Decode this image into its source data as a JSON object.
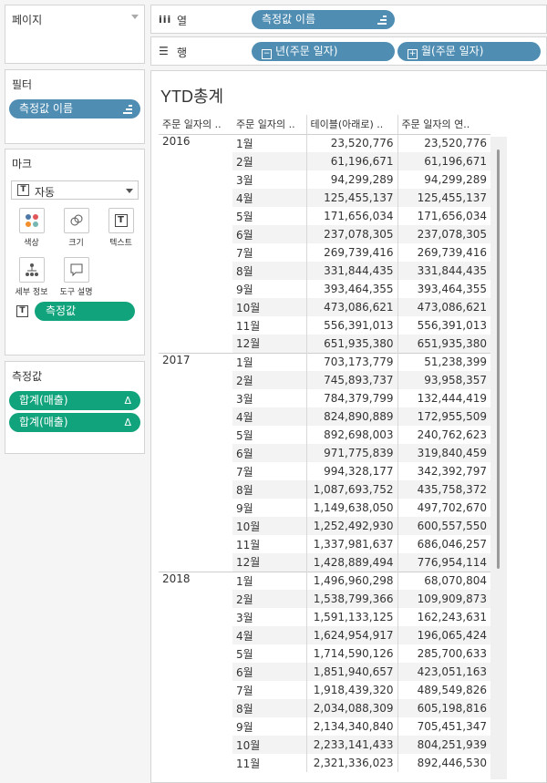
{
  "left": {
    "pages_title": "페이지",
    "filters_title": "필터",
    "filter_pill": "측정값 이름",
    "marks_title": "마크",
    "mark_type": "자동",
    "cards": [
      {
        "label": "색상",
        "icon": "color-dots-icon"
      },
      {
        "label": "크기",
        "icon": "size-circle-icon"
      },
      {
        "label": "텍스트",
        "icon": "text-box-icon"
      },
      {
        "label": "세부 정보",
        "icon": "detail-tree-icon"
      },
      {
        "label": "도구 설명",
        "icon": "tooltip-bubble-icon"
      }
    ],
    "text_pill": "측정값",
    "measures_title": "측정값",
    "measure_pills": [
      "합계(매출)",
      "합계(매출)"
    ]
  },
  "shelves": {
    "columns_label": "열",
    "columns_pill": "측정값 이름",
    "rows_label": "행",
    "rows_pills": [
      "년(주문 일자)",
      "월(주문 일자)"
    ]
  },
  "view": {
    "title": "YTD총계",
    "headers": [
      "주문 일자의 ..",
      "주문 일자의 ..",
      "테이블(아래로) ..",
      "주문 일자의 연.."
    ],
    "groups": [
      {
        "year": "2016",
        "rows": [
          [
            "1월",
            "23,520,776",
            "23,520,776"
          ],
          [
            "2월",
            "61,196,671",
            "61,196,671"
          ],
          [
            "3월",
            "94,299,289",
            "94,299,289"
          ],
          [
            "4월",
            "125,455,137",
            "125,455,137"
          ],
          [
            "5월",
            "171,656,034",
            "171,656,034"
          ],
          [
            "6월",
            "237,078,305",
            "237,078,305"
          ],
          [
            "7월",
            "269,739,416",
            "269,739,416"
          ],
          [
            "8월",
            "331,844,435",
            "331,844,435"
          ],
          [
            "9월",
            "393,464,355",
            "393,464,355"
          ],
          [
            "10월",
            "473,086,621",
            "473,086,621"
          ],
          [
            "11월",
            "556,391,013",
            "556,391,013"
          ],
          [
            "12월",
            "651,935,380",
            "651,935,380"
          ]
        ]
      },
      {
        "year": "2017",
        "rows": [
          [
            "1월",
            "703,173,779",
            "51,238,399"
          ],
          [
            "2월",
            "745,893,737",
            "93,958,357"
          ],
          [
            "3월",
            "784,379,799",
            "132,444,419"
          ],
          [
            "4월",
            "824,890,889",
            "172,955,509"
          ],
          [
            "5월",
            "892,698,003",
            "240,762,623"
          ],
          [
            "6월",
            "971,775,839",
            "319,840,459"
          ],
          [
            "7월",
            "994,328,177",
            "342,392,797"
          ],
          [
            "8월",
            "1,087,693,752",
            "435,758,372"
          ],
          [
            "9월",
            "1,149,638,050",
            "497,702,670"
          ],
          [
            "10월",
            "1,252,492,930",
            "600,557,550"
          ],
          [
            "11월",
            "1,337,981,637",
            "686,046,257"
          ],
          [
            "12월",
            "1,428,889,494",
            "776,954,114"
          ]
        ]
      },
      {
        "year": "2018",
        "rows": [
          [
            "1월",
            "1,496,960,298",
            "68,070,804"
          ],
          [
            "2월",
            "1,538,799,366",
            "109,909,873"
          ],
          [
            "3월",
            "1,591,133,125",
            "162,243,631"
          ],
          [
            "4월",
            "1,624,954,917",
            "196,065,424"
          ],
          [
            "5월",
            "1,714,590,126",
            "285,700,633"
          ],
          [
            "6월",
            "1,851,940,657",
            "423,051,163"
          ],
          [
            "7월",
            "1,918,439,320",
            "489,549,826"
          ],
          [
            "8월",
            "2,034,088,309",
            "605,198,816"
          ],
          [
            "9월",
            "2,134,340,840",
            "705,451,347"
          ],
          [
            "10월",
            "2,233,141,433",
            "804,251,939"
          ],
          [
            "11월",
            "2,321,336,023",
            "892,446,530"
          ]
        ]
      }
    ]
  },
  "colors": {
    "pill_blue": "#4f8db3",
    "pill_green": "#11a37b"
  }
}
